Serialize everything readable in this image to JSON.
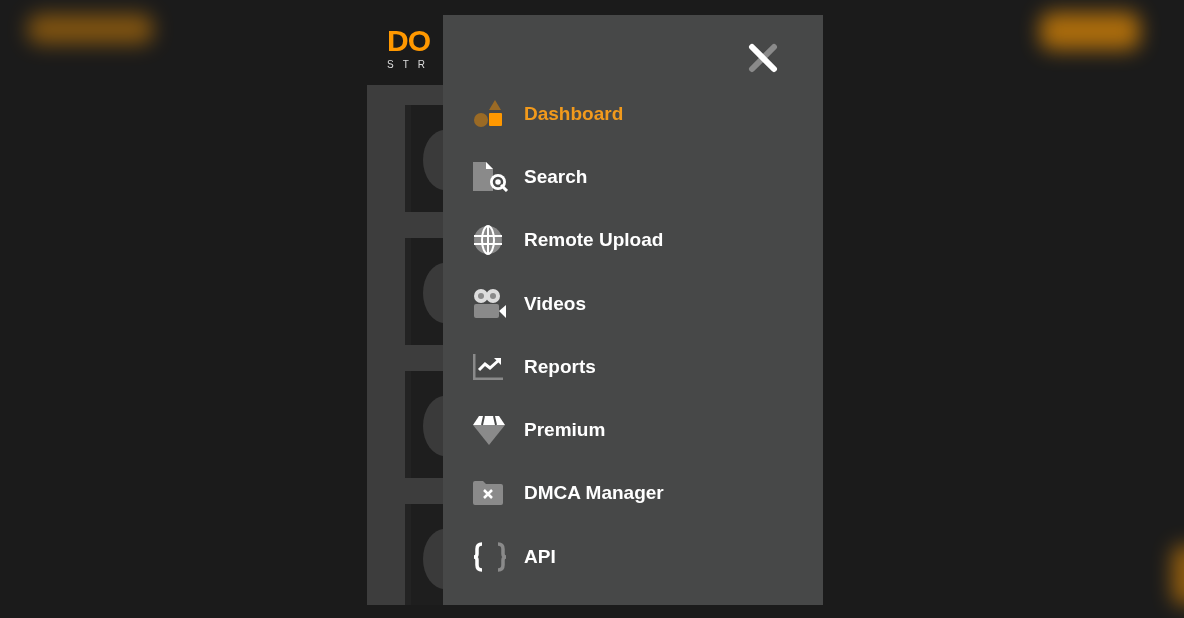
{
  "logo": {
    "mark": "DO",
    "tagline": "STR"
  },
  "menu": {
    "items": [
      {
        "label": "Dashboard",
        "selected": true
      },
      {
        "label": "Search",
        "selected": false
      },
      {
        "label": "Remote Upload",
        "selected": false
      },
      {
        "label": "Videos",
        "selected": false
      },
      {
        "label": "Reports",
        "selected": false
      },
      {
        "label": "Premium",
        "selected": false
      },
      {
        "label": "DMCA Manager",
        "selected": false
      },
      {
        "label": "API",
        "selected": false
      }
    ]
  }
}
